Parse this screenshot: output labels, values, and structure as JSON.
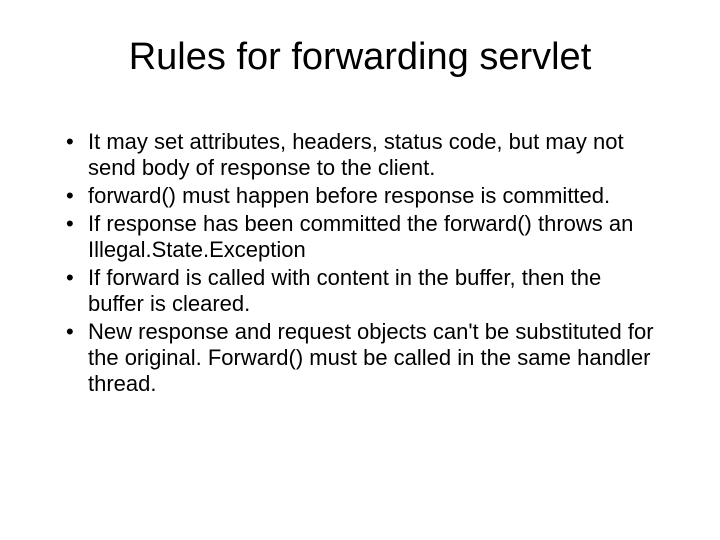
{
  "slide": {
    "title": "Rules for forwarding servlet",
    "bullets": [
      "It may set attributes, headers, status code, but may not send body of response to the client.",
      "forward() must happen before response is committed.",
      "If response has been committed the forward() throws an Illegal.State.Exception",
      "If forward is called with content in the buffer, then the buffer is cleared.",
      "New response and request objects can't be substituted for the original.  Forward() must be called in the same handler thread."
    ]
  }
}
